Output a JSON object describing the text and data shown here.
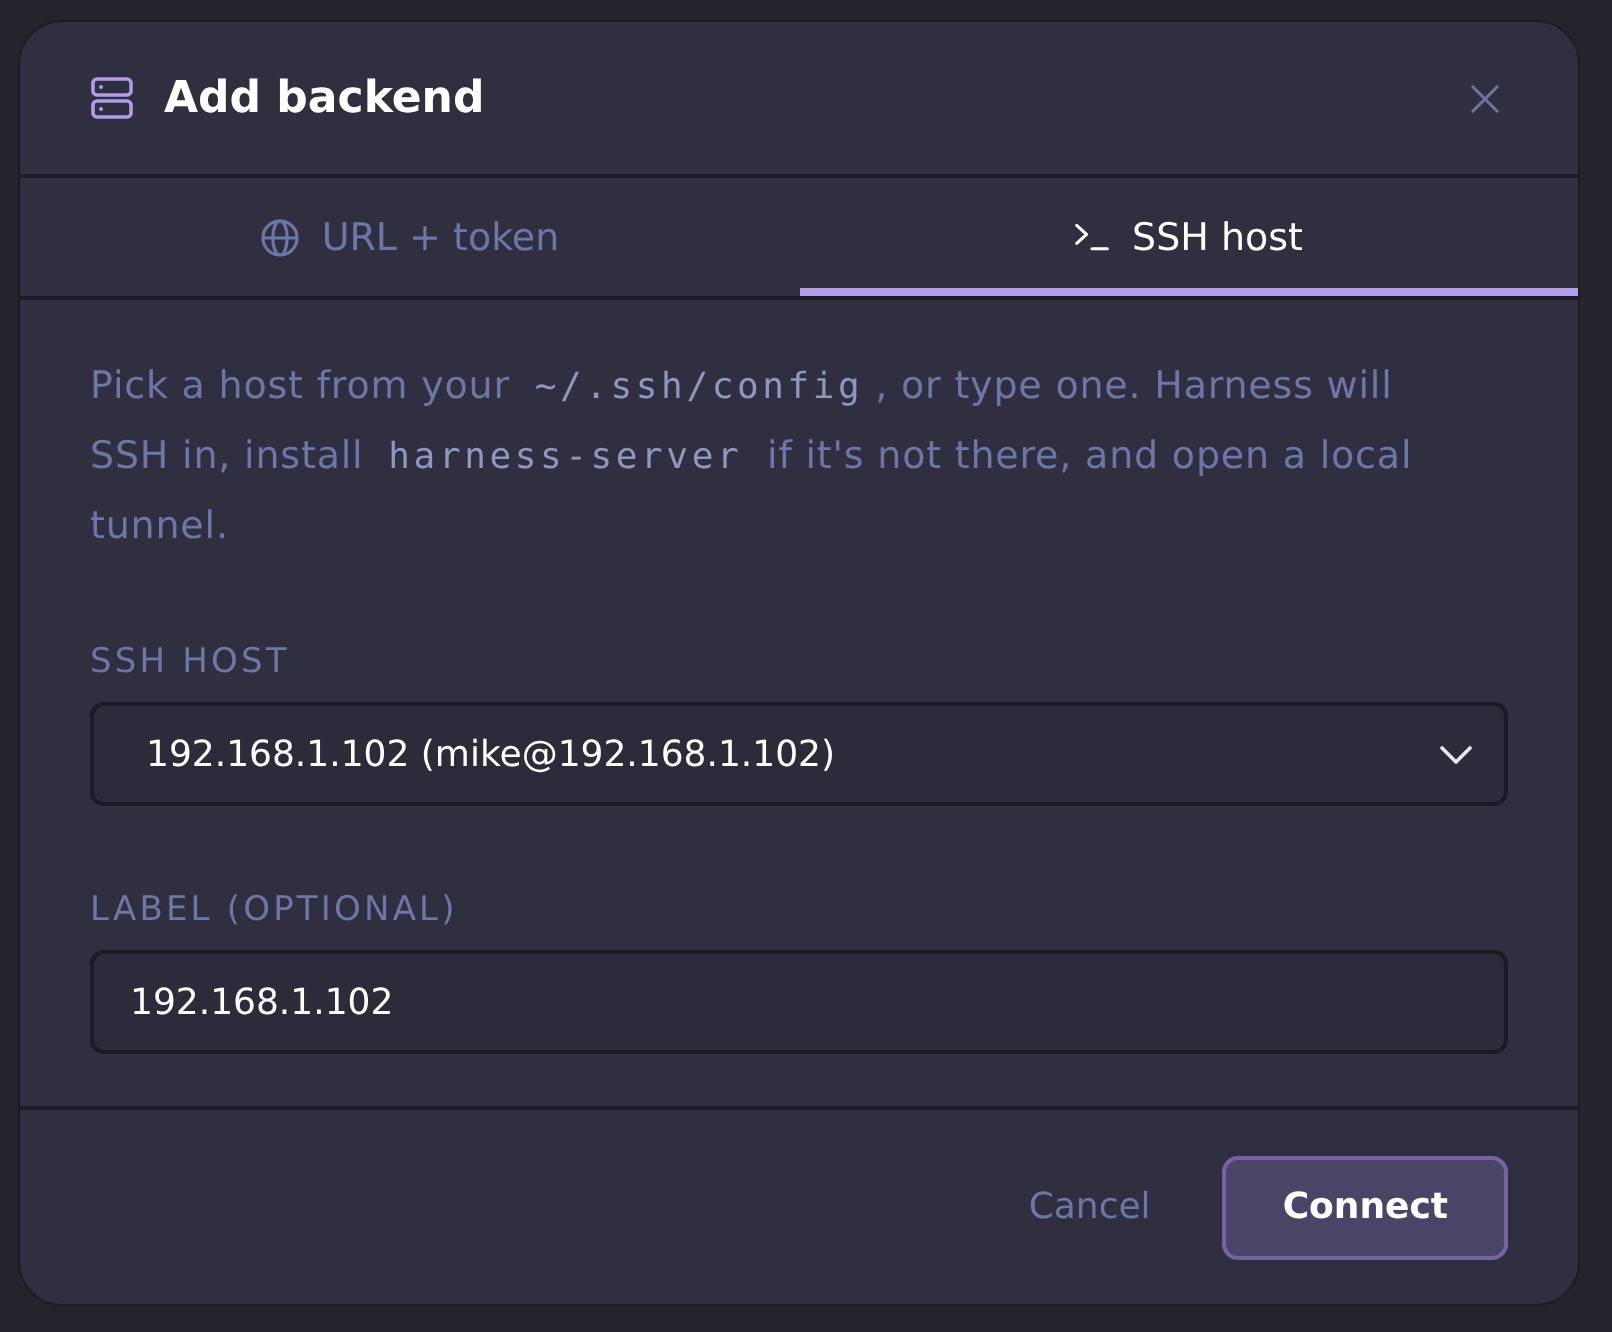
{
  "dialog": {
    "title": "Add backend"
  },
  "tabs": [
    {
      "kind": "url",
      "label": "URL + token",
      "selected": false
    },
    {
      "kind": "ssh",
      "label": "SSH host",
      "selected": true
    }
  ],
  "description": [
    {
      "kind": "text",
      "text": "Pick a host from your "
    },
    {
      "kind": "code",
      "text": "~/.ssh/config"
    },
    {
      "kind": "text",
      "text": ", or type one. Harness will SSH in, install "
    },
    {
      "kind": "code",
      "text": "harness-server"
    },
    {
      "kind": "text",
      "text": " if it's not there, and open a local tunnel."
    }
  ],
  "fields": [
    {
      "kind": "select",
      "label": "SSH HOST",
      "value": "192.168.1.102 (mike@192.168.1.102)"
    },
    {
      "kind": "input",
      "label": "LABEL (OPTIONAL)",
      "value": "192.168.1.102"
    }
  ],
  "buttons": [
    {
      "kind": "secondary",
      "label": "Cancel"
    },
    {
      "kind": "primary",
      "label": "Connect"
    }
  ]
}
